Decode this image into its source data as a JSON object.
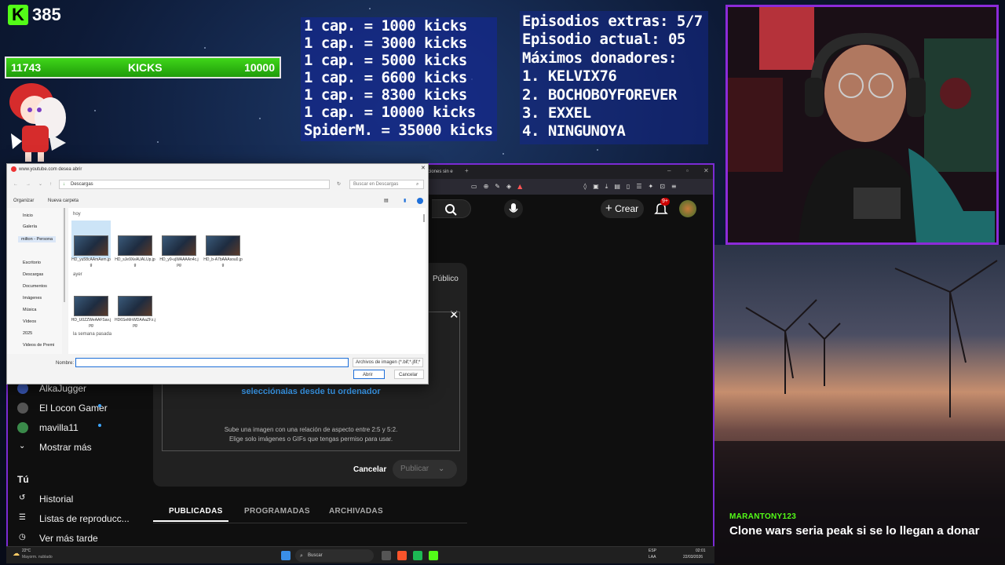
{
  "overlay": {
    "kick_count": "385",
    "goal": {
      "current": "11743",
      "label": "KICKS",
      "target": "10000",
      "progress": 1.0
    },
    "cap_lines": [
      "1 cap. = 1000 kicks",
      "1 cap. = 3000 kicks",
      "1 cap. = 5000 kicks",
      "1 cap. = 6600 kicks",
      "1 cap. = 8300 kicks",
      "1 cap. = 10000 kicks",
      "SpiderM. = 35000 kicks"
    ],
    "info_lines": [
      "Episodios extras: 5/7",
      "Episodio actual: 05",
      "Máximos donadores:",
      "1. KELVIX76",
      "2. BOCHOBOYFOREVER",
      "3. EXXEL",
      "4. NINGUNOYA"
    ],
    "chat": {
      "user": "MARANTONY123",
      "message": "Clone wars seria peak si se lo llegan a donar"
    },
    "accent_color": "#53fc18",
    "frame_color": "#8c2bd9"
  },
  "browser": {
    "tab_title": "...ciones sin e",
    "youtube": {
      "create_label": "Crear",
      "notif_badge": "9+",
      "visibility_label": "Público",
      "drop_link": "selecciónalas desde tu ordenador",
      "drop_hint_1": "Sube una imagen con una relación de aspecto entre 2:5 y 5:2.",
      "drop_hint_2": "Elige solo imágenes o GIFs que tengas permiso para usar.",
      "cancel_label": "Cancelar",
      "publish_label": "Publicar",
      "sidebar": [
        {
          "label": "AlkaJugger",
          "icon": "avatar"
        },
        {
          "label": "El Locon Gamer",
          "icon": "avatar"
        },
        {
          "label": "mavilla11",
          "icon": "avatar"
        },
        {
          "label": "Mostrar más",
          "icon": "chevron-down-icon"
        },
        {
          "label": "Tú",
          "icon": ""
        },
        {
          "label": "Historial",
          "icon": "history-icon"
        },
        {
          "label": "Listas de reproducc...",
          "icon": "playlist-icon"
        },
        {
          "label": "Ver más tarde",
          "icon": "clock-icon"
        }
      ],
      "tabs": [
        "PUBLICADAS",
        "PROGRAMADAS",
        "ARCHIVADAS"
      ]
    }
  },
  "dialog": {
    "title": "www.youtube.com desea abrir",
    "path": "Descargas",
    "search_placeholder": "Buscar en Descargas",
    "organize": "Organizar",
    "new_folder": "Nueva carpeta",
    "nav": [
      "Inicio",
      "Galería",
      "milton - Persona",
      "Escritorio",
      "Descargas",
      "Documentos",
      "Imágenes",
      "Música",
      "Vídeos",
      "2025",
      "Videos de Premi"
    ],
    "groups": [
      {
        "label": "hoy",
        "files": [
          "HD_yu58cAAmAem.jpg",
          "HD_sJe9XeAUALUp.jpg",
          "HD_y9-ujWAAAAn4c.jpg",
          "HD_b-A7bAAAsou0.jpg"
        ]
      },
      {
        "label": "ayer",
        "files": [
          "HD_U0ZZWeAAFSav.jpg",
          "HD6SeMnWDAAaZFz.jpg"
        ]
      },
      {
        "label": "la semana pasada",
        "files": []
      }
    ],
    "name_label": "Nombre:",
    "name_value": "",
    "filter": "Archivos de imagen (*.bif;*.jfif;*",
    "open_btn": "Abrir",
    "cancel_btn": "Cancelar"
  },
  "taskbar": {
    "weather_temp": "22°C",
    "weather_text": "Mayorm. nublado",
    "search": "Buscar",
    "lang": "ESP",
    "lang2": "LAA",
    "time": "02:01",
    "date": "22/03/2026"
  }
}
